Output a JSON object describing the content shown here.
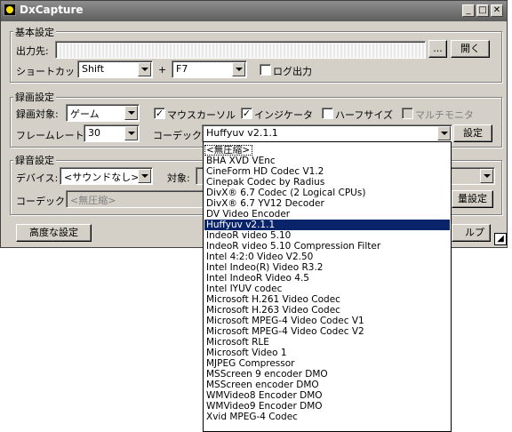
{
  "window": {
    "title": "DxCapture"
  },
  "basic": {
    "group_label": "基本設定",
    "output_label": "出力先:",
    "output_value": "",
    "browse_label": "...",
    "open_label": "開く",
    "shortcut_label": "ショートカット:",
    "shortcut_mod": "Shift",
    "plus": "+",
    "shortcut_key": "F7",
    "log_label": "ログ出力"
  },
  "video": {
    "group_label": "録画設定",
    "target_label": "録画対象:",
    "target_value": "ゲーム",
    "mouse_cursor_label": "マウスカーソル",
    "indicator_label": "インジケータ",
    "half_size_label": "ハーフサイズ",
    "multi_monitor_label": "マルチモニタ",
    "framerate_label": "フレームレート:",
    "framerate_value": "30",
    "codec_label": "コーデック:",
    "codec_value": "Huffyuv v2.1.1",
    "settings_label": "設定"
  },
  "audio": {
    "group_label": "録音設定",
    "device_label": "デバイス:",
    "device_value": "<サウンドなし>",
    "target_label": "対象:",
    "codec_label": "コーデック:",
    "codec_value": "<無圧縮>",
    "volume_settings_label": "量設定"
  },
  "footer": {
    "advanced_label": "高度な設定",
    "help_label": "ルプ"
  },
  "codec_list": [
    "<無圧縮>",
    "BHA XVD VEnc",
    "CineForm HD Codec V1.2",
    "Cinepak Codec by Radius",
    "DivX® 6.7 Codec (2 Logical CPUs)",
    "DivX® 6.7 YV12 Decoder",
    "DV Video Encoder",
    "Huffyuv v2.1.1",
    "IndeoR video 5.10",
    "IndeoR video 5.10 Compression Filter",
    "Intel 4:2:0 Video V2.50",
    "Intel Indeo(R) Video R3.2",
    "Intel IndeoR Video 4.5",
    "Intel IYUV codec",
    "Microsoft H.261 Video Codec",
    "Microsoft H.263 Video Codec",
    "Microsoft MPEG-4 Video Codec V1",
    "Microsoft MPEG-4 Video Codec V2",
    "Microsoft RLE",
    "Microsoft Video 1",
    "MJPEG Compressor",
    "MSScreen 9 encoder DMO",
    "MSScreen encoder DMO",
    "WMVideo8 Encoder DMO",
    "WMVideo9 Encoder DMO",
    "Xvid MPEG-4 Codec"
  ],
  "selected_codec_index": 7
}
